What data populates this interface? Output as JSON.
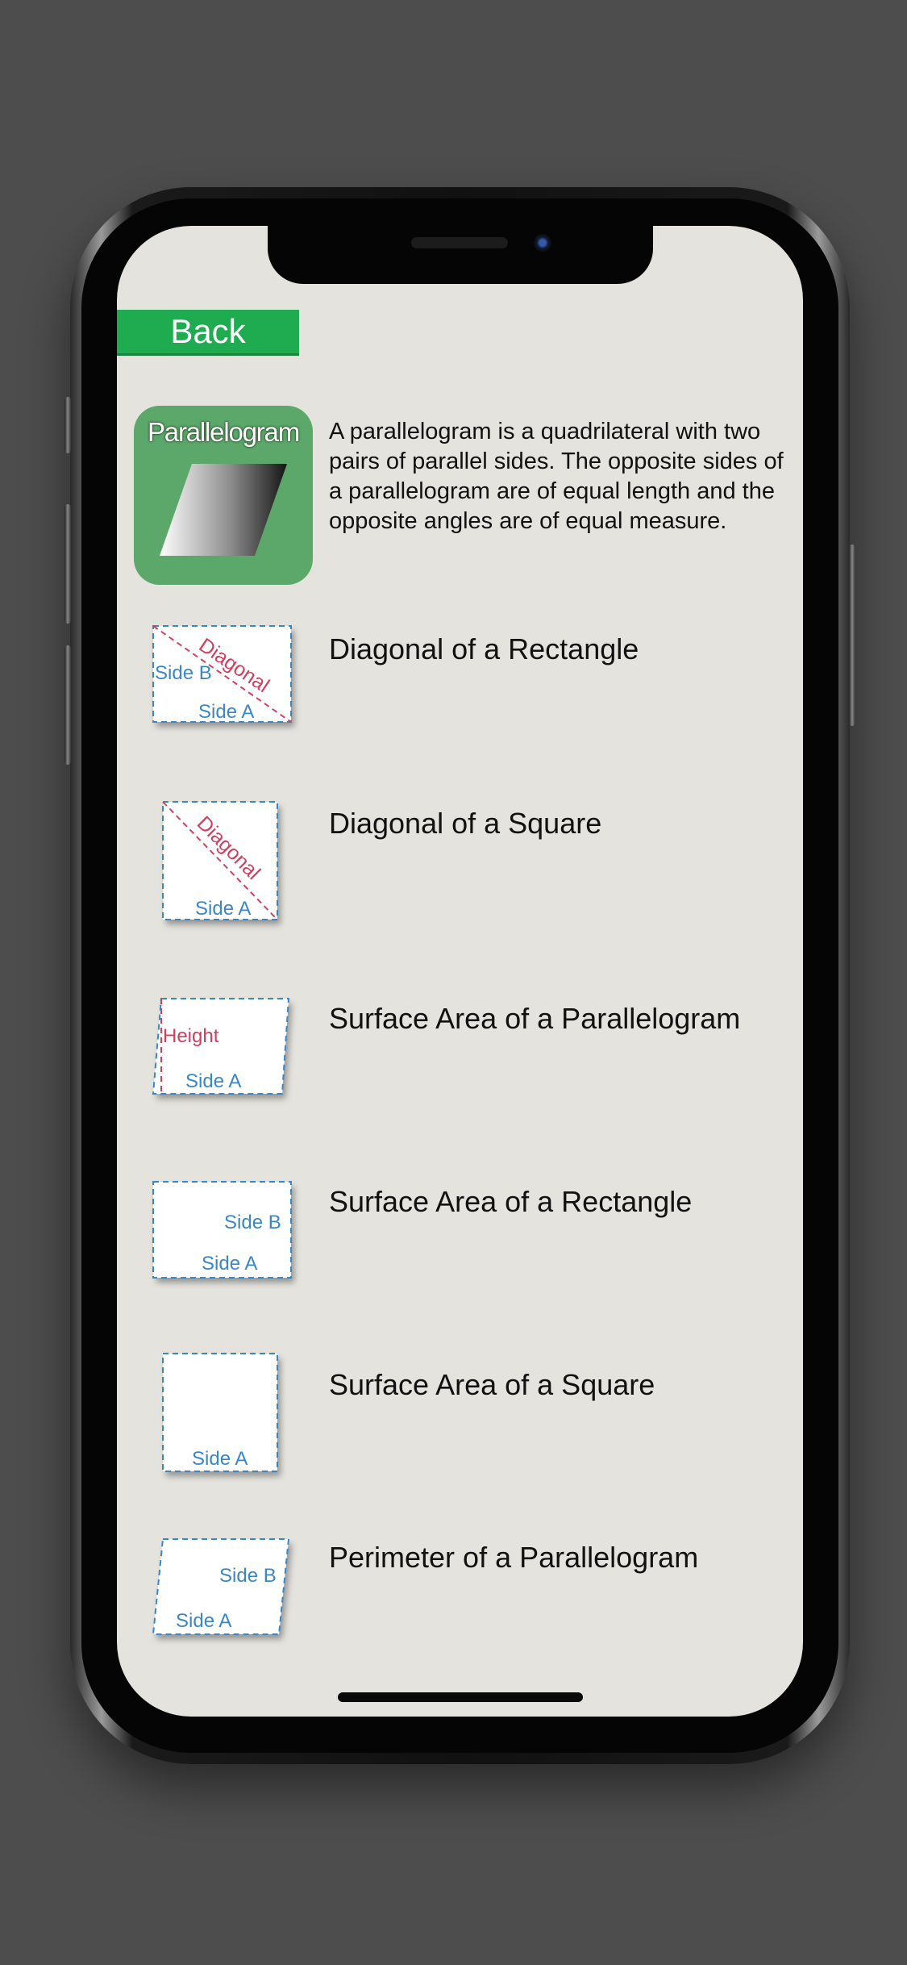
{
  "back_button": {
    "label": "Back"
  },
  "feature": {
    "title": "Parallelogram",
    "description": "A parallelogram is a quadrilateral with two pairs of parallel sides. The opposite sides of a parallelogram are of equal length and the opposite angles are of equal measure."
  },
  "thumb_labels": {
    "side_a": "Side A",
    "side_b": "Side B",
    "diagonal": "Diagonal",
    "height": "Height"
  },
  "formulas": [
    {
      "label": "Diagonal of a Rectangle"
    },
    {
      "label": "Diagonal of a Square"
    },
    {
      "label": "Surface Area of a Parallelogram"
    },
    {
      "label": "Surface Area of a Rectangle"
    },
    {
      "label": "Surface Area of a Square"
    },
    {
      "label": "Perimeter of a Parallelogram"
    }
  ],
  "colors": {
    "background": "#e4e3de",
    "back_button": "#1fac50",
    "feature_icon_bg": "#5ca86b",
    "side_label": "#3b86c5",
    "diagonal_label": "#d0405e"
  }
}
